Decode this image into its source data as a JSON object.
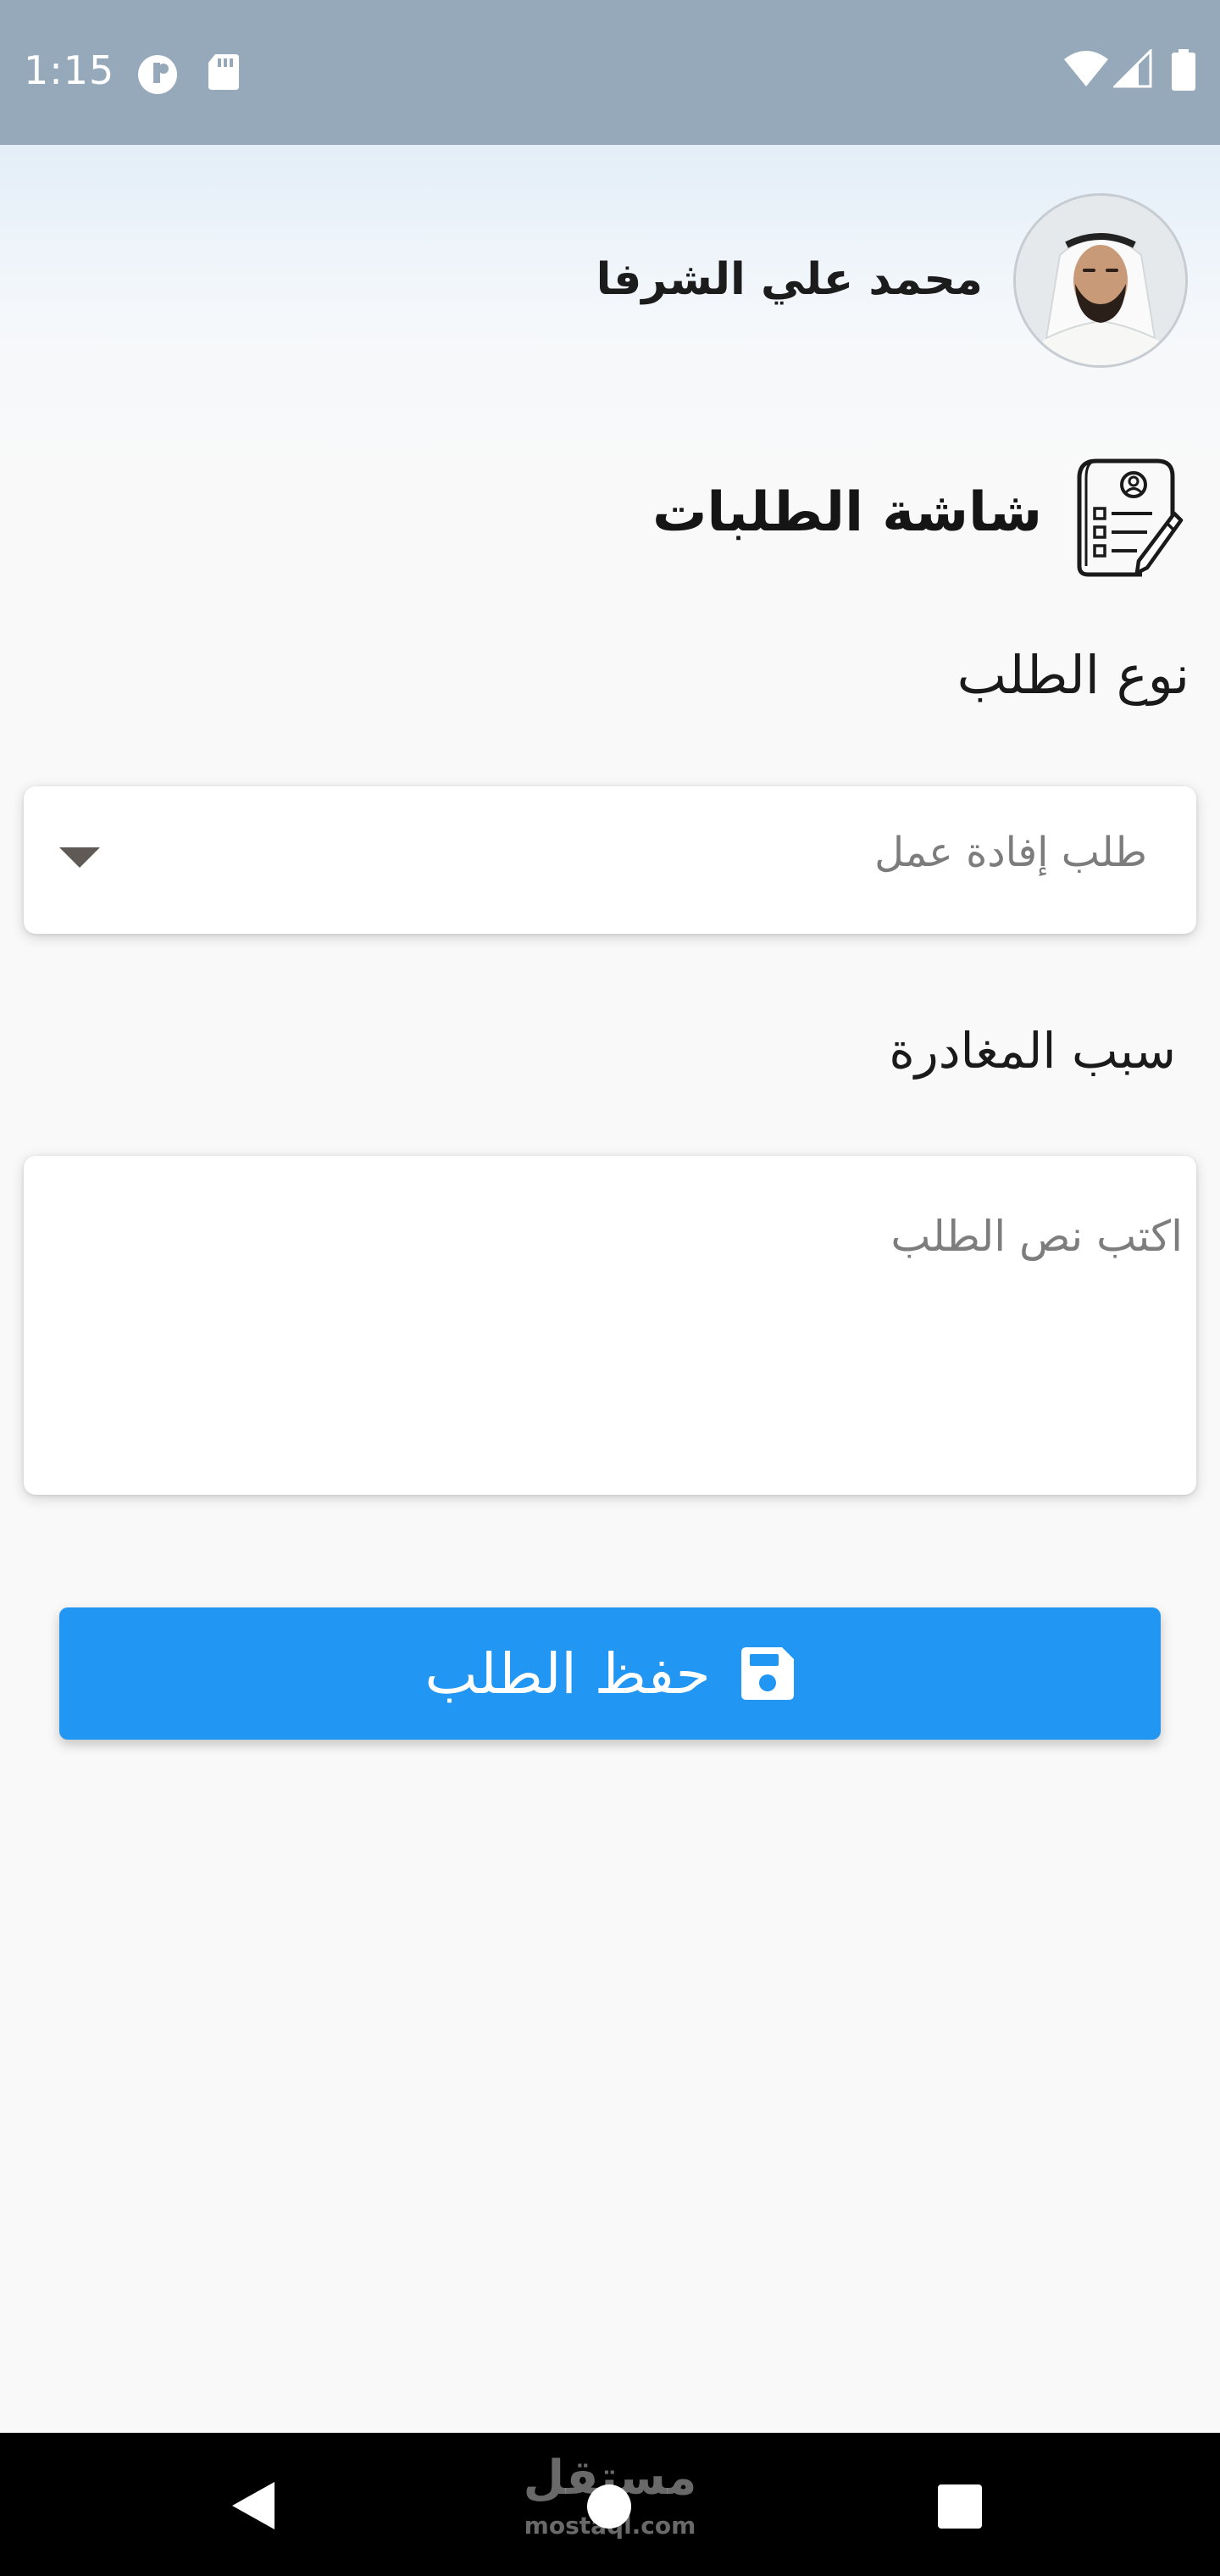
{
  "status_bar": {
    "time": "1:15",
    "left_icons": [
      "data-saver-icon",
      "sd-card-icon"
    ],
    "right_icons": [
      "wifi-icon",
      "cell-signal-icon",
      "battery-icon"
    ]
  },
  "header": {
    "user_name": "محمد علي الشرفا",
    "avatar_icon": "user-avatar"
  },
  "page": {
    "title": "شاشة الطلبات",
    "title_icon": "request-document-icon"
  },
  "form": {
    "type_label": "نوع الطلب",
    "type_value": "طلب إفادة عمل",
    "reason_label": "سبب المغادرة",
    "text_placeholder": "اكتب نص الطلب",
    "text_value": ""
  },
  "actions": {
    "save_label": "حفظ الطلب",
    "save_icon": "floppy-disk-icon"
  },
  "nav_bar": {
    "buttons": [
      "back-icon",
      "home-icon",
      "recents-icon"
    ],
    "watermark": "مستقل",
    "watermark_sub": "mostaql.com"
  },
  "colors": {
    "status_bar": "#96a9bb",
    "accent": "#2196f3",
    "background": "#f9f9f9",
    "nav_bar": "#000000"
  }
}
